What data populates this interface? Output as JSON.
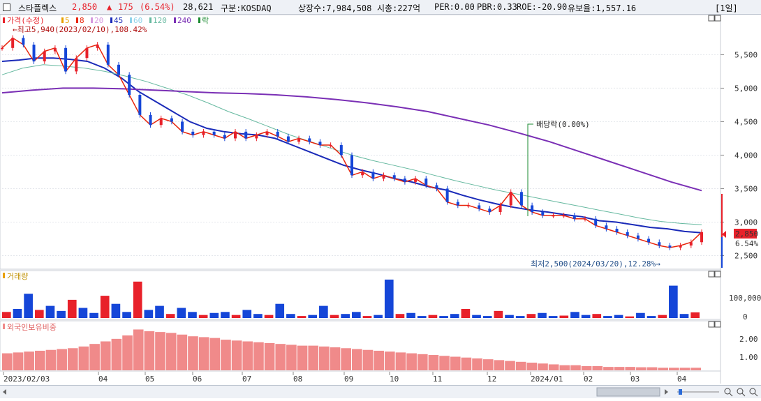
{
  "header": {
    "name": "스타플렉스",
    "price": "2,850",
    "arrow": "▲",
    "change": "175",
    "change_pct": "(6.54%)",
    "volume": "28,621",
    "market": "구분:KOSDAQ",
    "shares": "상장수:7,984,508",
    "mcap": "시총:227억",
    "per": "PER:0.00",
    "pbr": "PBR:0.33",
    "roe": "ROE:-20.90",
    "reserve": "유보율:1,557.16",
    "period": "[1일]"
  },
  "legend": {
    "price_label": "가격(수정)",
    "ma": [
      {
        "label": "5",
        "color": "#e8a000"
      },
      {
        "label": "8",
        "color": "#e8240a"
      },
      {
        "label": "20",
        "color": "#d69adf"
      },
      {
        "label": "45",
        "color": "#1a2ab8"
      },
      {
        "label": "60",
        "color": "#8fd3ea"
      },
      {
        "label": "120",
        "color": "#66b9a0"
      },
      {
        "label": "240",
        "color": "#7a2fb5"
      }
    ],
    "ex_label": "락"
  },
  "annotations": {
    "high": "←최고5,940(2023/02/10),108.42%",
    "low": "최저2,500(2024/03/20),12.28%→",
    "dividend": "배당락(0.00%)",
    "last_price": "2,850",
    "last_pct": "6.54%"
  },
  "volume_panel": {
    "title": "거래량",
    "ticks": [
      "100,000",
      "0"
    ]
  },
  "foreign_panel": {
    "title": "외국인보유비중",
    "ticks": [
      "2.00",
      "1.00"
    ]
  },
  "colors": {
    "up": "#e8212a",
    "down": "#1546d8",
    "ma5": "#e8a000",
    "ma8": "#e8240a",
    "ma20": "#d69adf",
    "ma45": "#1a2ab8",
    "ma120": "#66b9a0",
    "ma240": "#7a2fb5",
    "foreign": "#f08a8a"
  },
  "chart_data": {
    "type": "line",
    "title": "스타플렉스",
    "x_labels": [
      "2023/02/03",
      "04",
      "05",
      "06",
      "07",
      "08",
      "09",
      "10",
      "11",
      "12",
      "2024/01",
      "02",
      "03",
      "04"
    ],
    "y_ticks": [
      "5,500",
      "5,000",
      "4,500",
      "4,000",
      "3,500",
      "3,000",
      "2,500"
    ],
    "ylim": [
      2380,
      5900
    ],
    "price_series": {
      "name": "가격(수정)",
      "values": [
        5600,
        5750,
        5650,
        5400,
        5550,
        5600,
        5250,
        5450,
        5600,
        5650,
        5350,
        5200,
        4900,
        4600,
        4450,
        4550,
        4500,
        4350,
        4300,
        4350,
        4300,
        4250,
        4350,
        4250,
        4300,
        4350,
        4280,
        4200,
        4250,
        4200,
        4150,
        4150,
        4000,
        3700,
        3750,
        3650,
        3700,
        3650,
        3600,
        3650,
        3550,
        3500,
        3300,
        3250,
        3250,
        3200,
        3150,
        3250,
        3450,
        3250,
        3150,
        3100,
        3100,
        3100,
        3050,
        3050,
        2950,
        2900,
        2850,
        2800,
        2750,
        2700,
        2650,
        2620,
        2650,
        2700,
        2850
      ]
    },
    "series": [
      {
        "name": "45",
        "values": [
          5400,
          5420,
          5450,
          5450,
          5430,
          5400,
          5300,
          5150,
          4950,
          4800,
          4650,
          4500,
          4400,
          4350,
          4320,
          4300,
          4250,
          4150,
          4050,
          3950,
          3850,
          3780,
          3720,
          3650,
          3600,
          3530,
          3480,
          3400,
          3330,
          3270,
          3220,
          3180,
          3150,
          3110,
          3080,
          3020,
          3000,
          2960,
          2920,
          2900,
          2860,
          2840
        ]
      },
      {
        "name": "120",
        "values": [
          5200,
          5300,
          5350,
          5330,
          5300,
          5250,
          5180,
          5100,
          5000,
          4900,
          4780,
          4650,
          4540,
          4420,
          4300,
          4200,
          4100,
          4000,
          3920,
          3850,
          3780,
          3700,
          3620,
          3550,
          3480,
          3420,
          3360,
          3300,
          3240,
          3180,
          3120,
          3060,
          3010,
          2980,
          2960
        ]
      },
      {
        "name": "240",
        "values": [
          4930,
          4970,
          5000,
          5000,
          4990,
          4970,
          4950,
          4930,
          4920,
          4900,
          4870,
          4830,
          4780,
          4720,
          4650,
          4550,
          4450,
          4330,
          4200,
          4050,
          3900,
          3750,
          3600,
          3470
        ]
      }
    ],
    "volume_ylim": [
      0,
      200000
    ],
    "volume": [
      30000,
      45000,
      120000,
      40000,
      60000,
      35000,
      90000,
      50000,
      25000,
      110000,
      70000,
      30000,
      180000,
      40000,
      60000,
      20000,
      50000,
      30000,
      15000,
      25000,
      30000,
      15000,
      40000,
      20000,
      15000,
      70000,
      20000,
      10000,
      15000,
      60000,
      15000,
      20000,
      30000,
      10000,
      15000,
      190000,
      20000,
      25000,
      10000,
      15000,
      10000,
      20000,
      45000,
      15000,
      10000,
      35000,
      15000,
      10000,
      20000,
      25000,
      10000,
      12000,
      30000,
      15000,
      20000,
      10000,
      15000,
      8000,
      25000,
      10000,
      15000,
      160000,
      20000,
      28000
    ],
    "foreign_ylim": [
      0,
      2.5
    ],
    "foreign": [
      1.0,
      1.05,
      1.1,
      1.15,
      1.2,
      1.25,
      1.3,
      1.4,
      1.55,
      1.7,
      1.85,
      2.05,
      2.4,
      2.3,
      2.25,
      2.2,
      2.1,
      2.0,
      1.95,
      1.9,
      1.8,
      1.75,
      1.7,
      1.65,
      1.6,
      1.55,
      1.5,
      1.45,
      1.45,
      1.4,
      1.35,
      1.3,
      1.25,
      1.2,
      1.15,
      1.1,
      1.05,
      1.0,
      0.95,
      0.9,
      0.85,
      0.8,
      0.75,
      0.7,
      0.65,
      0.6,
      0.55,
      0.5,
      0.45,
      0.4,
      0.35,
      0.3,
      0.3,
      0.25,
      0.25,
      0.2,
      0.2,
      0.2,
      0.18,
      0.18,
      0.15,
      0.15,
      0.15,
      0.15
    ]
  }
}
